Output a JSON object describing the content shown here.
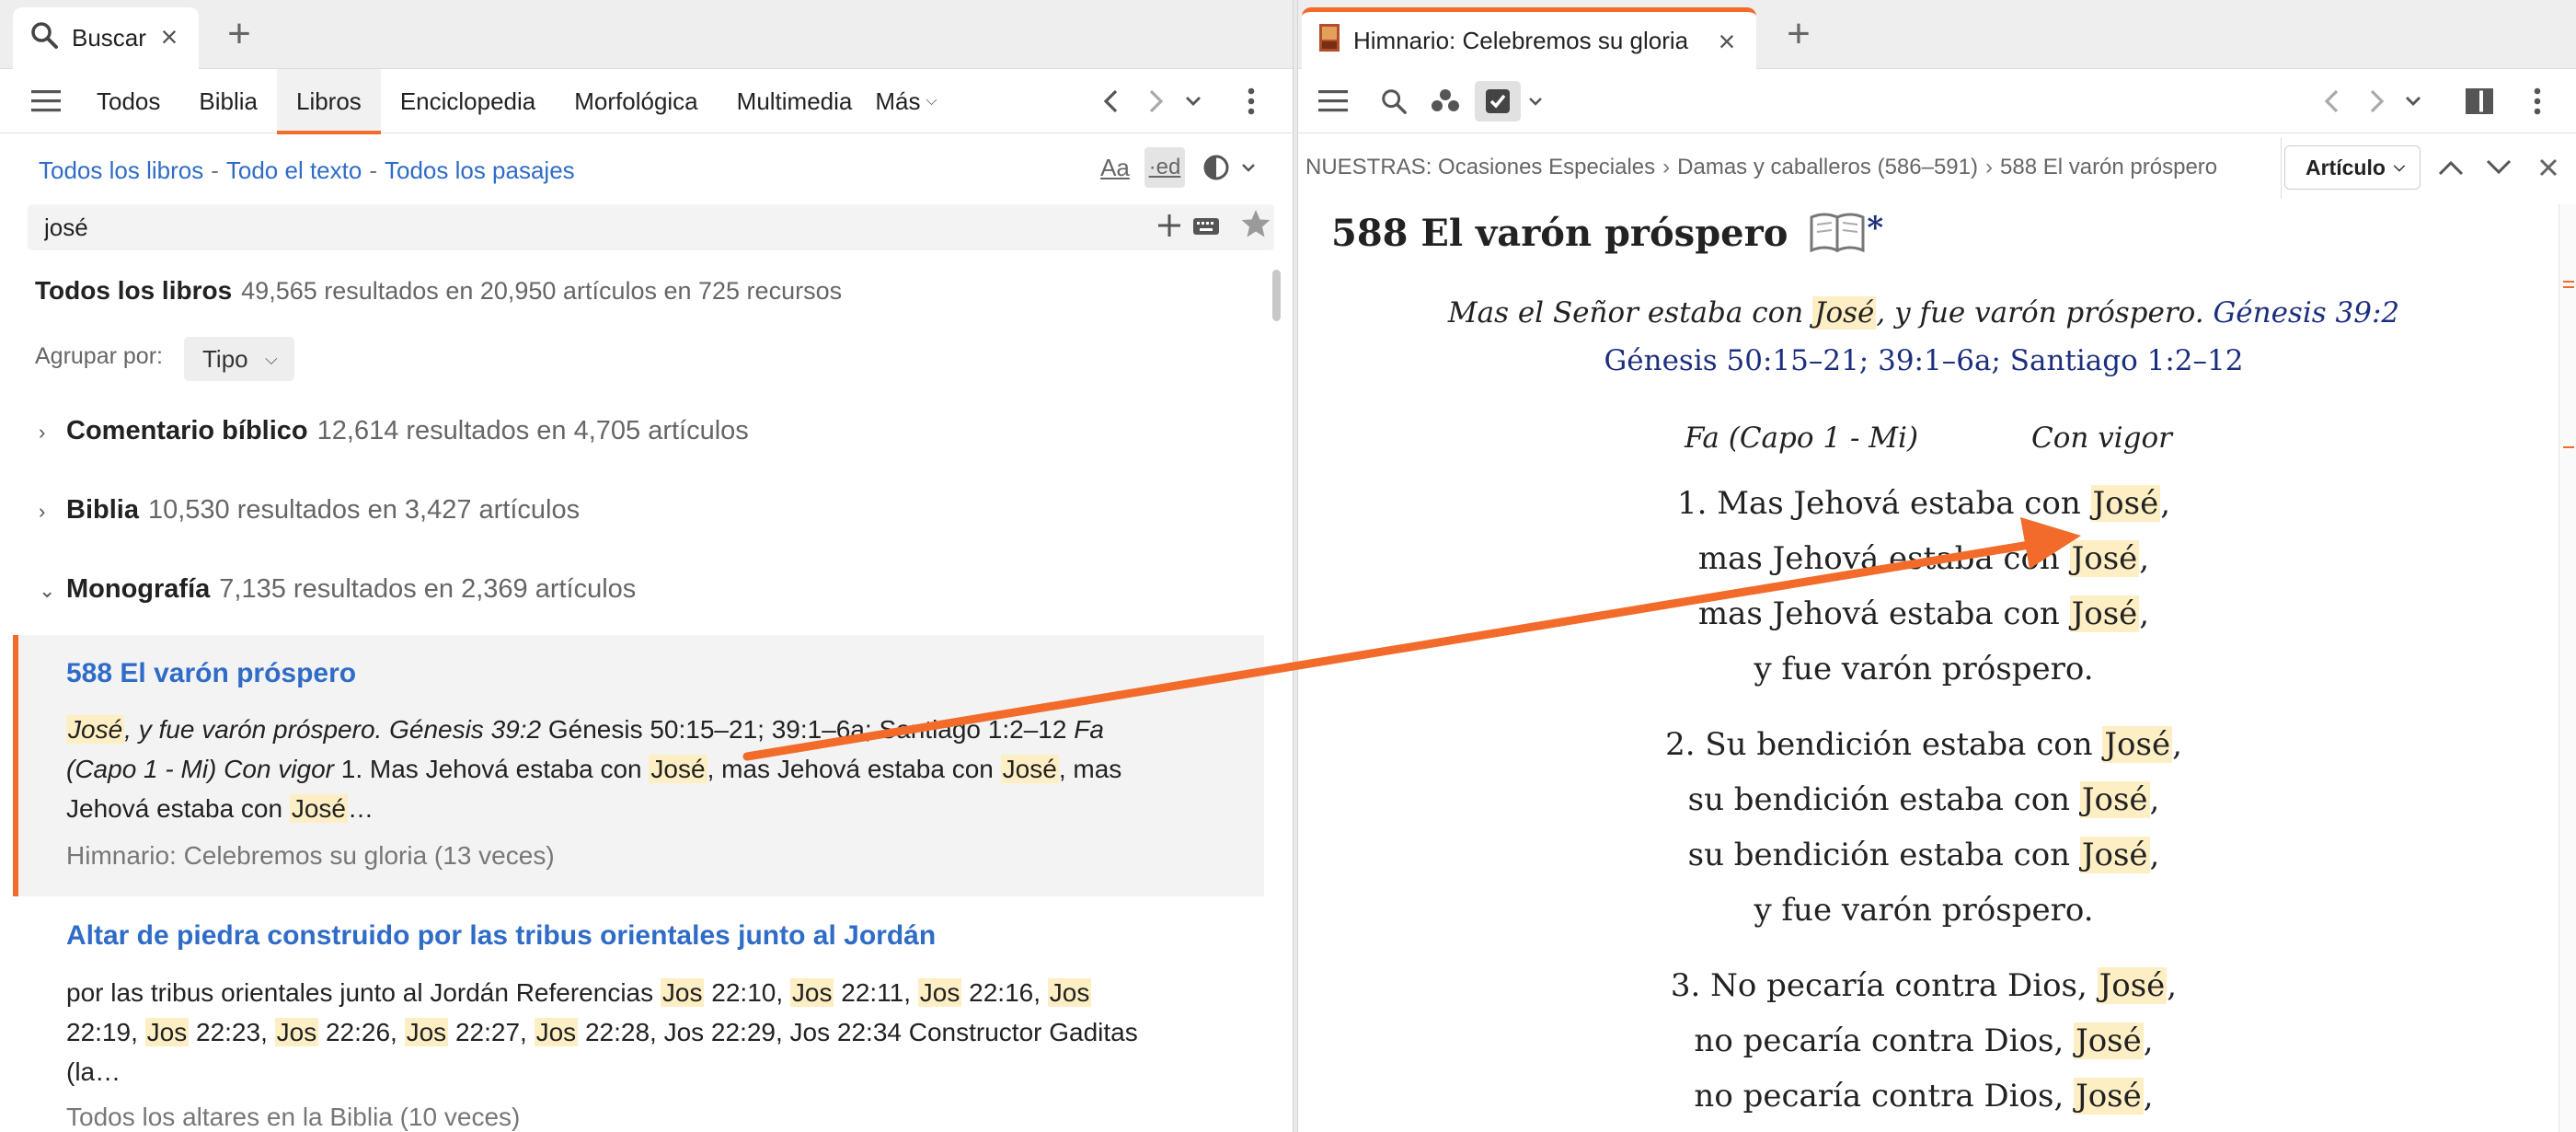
{
  "left": {
    "tab": {
      "label": "Buscar"
    },
    "nav_tabs": [
      {
        "label": "Todos"
      },
      {
        "label": "Biblia"
      },
      {
        "label": "Libros"
      },
      {
        "label": "Enciclopedia"
      },
      {
        "label": "Morfológica"
      },
      {
        "label": "Multimedia"
      },
      {
        "label": "Más"
      }
    ],
    "filters": [
      "Todos los libros",
      "Todo el texto",
      "Todos los pasajes"
    ],
    "filter_sep": "-",
    "tool_aa": "Aa",
    "tool_ed": "·ed",
    "search": {
      "value": "josé"
    },
    "results_head": {
      "title": "Todos los libros",
      "summary": "49,565 resultados en 20,950 artículos en 725 recursos"
    },
    "group_by": {
      "label": "Agrupar por:",
      "value": "Tipo"
    },
    "categories": [
      {
        "name": "Comentario bíblico",
        "summary": "12,614 resultados en 4,705 artículos"
      },
      {
        "name": "Biblia",
        "summary": "10,530 resultados en 3,427 artículos"
      },
      {
        "name": "Monografía",
        "summary": "7,135 resultados en 2,369 artículos"
      }
    ],
    "result1": {
      "title": "588 El varón próspero",
      "line1": [
        {
          "t": "José",
          "hl": true,
          "i": true
        },
        {
          "t": ", y fue varón próspero. Génesis 39:2",
          "i": true
        },
        {
          "t": " Génesis 50:15–21; 39:1–6a; Santiago 1:2–12 "
        },
        {
          "t": "Fa",
          "i": true
        }
      ],
      "line2": [
        {
          "t": "(Capo 1 - Mi) Con vigor",
          "i": true
        },
        {
          "t": " 1. Mas Jehová estaba con "
        },
        {
          "t": "José",
          "hl": true
        },
        {
          "t": ", mas Jehová estaba con "
        },
        {
          "t": "José",
          "hl": true
        },
        {
          "t": ", mas"
        }
      ],
      "line3": [
        {
          "t": "Jehová estaba con "
        },
        {
          "t": "José",
          "hl": true
        },
        {
          "t": "…"
        }
      ],
      "source": "Himnario: Celebremos su gloria (13 veces)"
    },
    "result2": {
      "title": "Altar de piedra construido por las tribus orientales junto al Jordán",
      "line1": [
        {
          "t": "por las tribus orientales junto al Jordán Referencias "
        },
        {
          "t": "Jos",
          "hl": true
        },
        {
          "t": " 22:10, "
        },
        {
          "t": "Jos",
          "hl": true
        },
        {
          "t": " 22:11, "
        },
        {
          "t": "Jos",
          "hl": true
        },
        {
          "t": " 22:16, "
        },
        {
          "t": "Jos",
          "hl": true
        }
      ],
      "line2": [
        {
          "t": "22:19, "
        },
        {
          "t": "Jos",
          "hl": true
        },
        {
          "t": " 22:23, "
        },
        {
          "t": "Jos",
          "hl": true
        },
        {
          "t": " 22:26, "
        },
        {
          "t": "Jos",
          "hl": true
        },
        {
          "t": " 22:27, "
        },
        {
          "t": "Jos",
          "hl": true
        },
        {
          "t": " 22:28, Jos 22:29, Jos 22:34 Constructor Gaditas"
        }
      ],
      "line3": [
        {
          "t": "(la…"
        }
      ],
      "source": "Todos los altares en la Biblia (10 veces)"
    }
  },
  "right": {
    "tab": {
      "label": "Himnario: Celebremos su gloria"
    },
    "breadcrumbs": [
      "NUESTRAS: Ocasiones Especiales",
      "Damas y caballeros (586–591)",
      "588 El varón próspero"
    ],
    "crumb_sep": "›",
    "view_select": "Artículo",
    "doc": {
      "title": "588 El varón próspero",
      "title_mark": "*",
      "epigraph": [
        {
          "t": "Mas el Señor estaba con "
        },
        {
          "t": "José",
          "hl": true
        },
        {
          "t": ", y fue varón próspero. "
        },
        {
          "t": "Génesis 39:2",
          "ref": true
        }
      ],
      "refs": "Génesis 50:15–21; 39:1–6a; Santiago 1:2–12",
      "key": "Fa (Capo 1 - Mi)",
      "tempo": "Con vigor",
      "verses": [
        [
          {
            "pre": "1. Mas Jehová estaba con ",
            "hl": "José",
            "post": ","
          },
          {
            "pre": "mas Jehová estaba con ",
            "hl": "José",
            "post": ","
          },
          {
            "pre": "mas Jehová estaba con ",
            "hl": "José",
            "post": ","
          },
          {
            "pre": "y fue varón próspero.",
            "hl": "",
            "post": ""
          }
        ],
        [
          {
            "pre": "2. Su bendición estaba con ",
            "hl": "José",
            "post": ","
          },
          {
            "pre": "su bendición estaba con ",
            "hl": "José",
            "post": ","
          },
          {
            "pre": "su bendición estaba con ",
            "hl": "José",
            "post": ","
          },
          {
            "pre": "y fue varón próspero.",
            "hl": "",
            "post": ""
          }
        ],
        [
          {
            "pre": "3. No pecaría contra Dios, ",
            "hl": "José",
            "post": ","
          },
          {
            "pre": "no pecaría contra Dios, ",
            "hl": "José",
            "post": ","
          },
          {
            "pre": "no pecaría contra Dios, ",
            "hl": "José",
            "post": ","
          }
        ]
      ]
    }
  },
  "colors": {
    "accent": "#f26b2a",
    "link": "#2f6cc7",
    "highlight": "#fdeec4",
    "scripture_ref": "#1c2f7d"
  },
  "icons": [
    "search-icon",
    "close-icon",
    "plus-icon",
    "menu-icon",
    "chevron-left-icon",
    "chevron-right-icon",
    "chevron-down-icon",
    "more-vertical-icon",
    "text-size-icon",
    "ed-toggle-icon",
    "contrast-icon",
    "keyboard-icon",
    "star-icon",
    "book-icon",
    "people-icon",
    "checkbox-icon",
    "panel-layout-icon",
    "chevron-up-icon"
  ]
}
